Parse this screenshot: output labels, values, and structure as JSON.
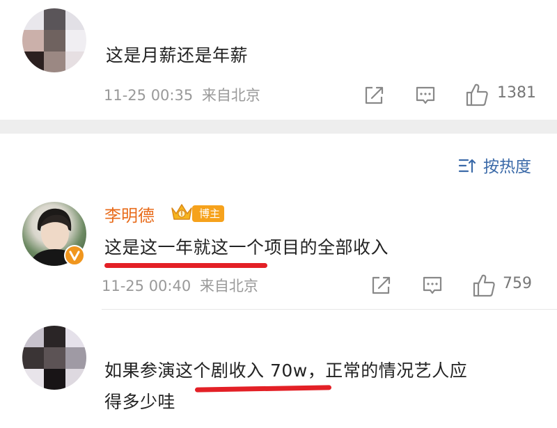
{
  "comments": [
    {
      "text": "这是月薪还是年薪",
      "time": "11-25 00:35",
      "location": "来自北京",
      "likes": "1381"
    },
    {
      "username": "李明德",
      "badge": "博主",
      "text": "这是这一年就这一个项目的全部收入",
      "time": "11-25 00:40",
      "location": "来自北京",
      "likes": "759"
    },
    {
      "text_line1": "如果参演这个剧收入 70w，正常的情况艺人应",
      "text_line2": "得多少哇"
    }
  ],
  "sort": {
    "label": "按热度"
  },
  "icons": {
    "share": "share-icon",
    "comment": "comment-icon",
    "like": "thumbs-up-icon",
    "sort": "sort-icon",
    "verified": "verified-v-icon",
    "crown": "crown-icon"
  },
  "colors": {
    "username": "#e86c1c",
    "sort_link": "#3b6aa8",
    "highlight_underline": "#e32026",
    "verified_badge": "#f0961e"
  }
}
